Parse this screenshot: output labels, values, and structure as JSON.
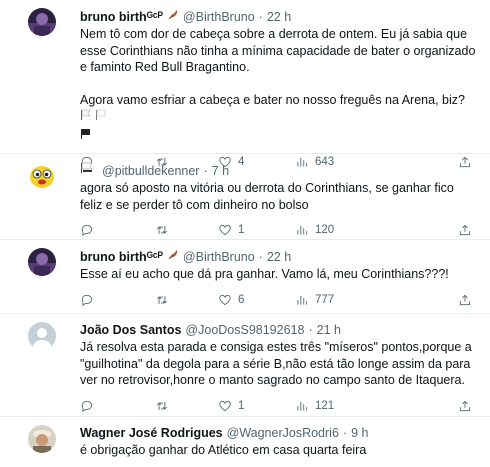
{
  "tweets": [
    {
      "name": "bruno birthᴳᶜᴾ",
      "handle": "@BirthBruno",
      "time": "22 h",
      "text1": "Nem tô com dor de cabeça sobre a derrota de ontem. Eu já sabia que esse Corinthians não tinha a mínima capacidade de bater o organizado e faminto Red Bull Bragantino.",
      "text2": "Agora vamo esfriar a cabeça e bater no nosso freguês na Arena, biz?",
      "replies": "",
      "retweets": "",
      "likes": "4",
      "views": "643"
    },
    {
      "name": "",
      "handle": "@pitbulldekenner",
      "time": "7 h",
      "text1": "agora só aposto na vitória ou derrota do Corinthians, se ganhar fico feliz e se perder tô com dinheiro no bolso",
      "replies": "",
      "retweets": "",
      "likes": "1",
      "views": "120"
    },
    {
      "name": "bruno birthᴳᶜᴾ",
      "handle": "@BirthBruno",
      "time": "22 h",
      "text1": "Esse aí eu acho que dá pra ganhar. Vamo lá, meu Corinthians???!",
      "replies": "",
      "retweets": "",
      "likes": "6",
      "views": "777"
    },
    {
      "name": "João Dos Santos",
      "handle": "@JooDosS98192618",
      "time": "21 h",
      "text1": "Já resolva esta parada e consiga estes três \"míseros\" pontos,porque a \"guilhotina\" da degola para a série B,não está tão longe assim da para ver no retrovisor,honre o manto sagrado no campo santo de Itaquera.",
      "replies": "",
      "retweets": "",
      "likes": "1",
      "views": "121"
    },
    {
      "name": "Wagner José Rodrigues",
      "handle": "@WagnerJosRodri6",
      "time": "9 h",
      "text1": "é obrigação ganhar do Atlético em casa quarta feira"
    }
  ],
  "separator": "·",
  "icons": {
    "reply": "reply-icon",
    "retweet": "retweet-icon",
    "like": "heart-icon",
    "views": "views-chart-icon",
    "share": "share-icon"
  }
}
